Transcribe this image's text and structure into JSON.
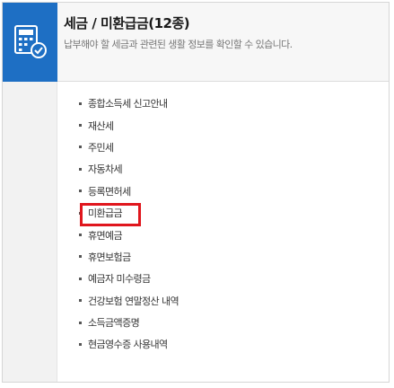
{
  "header": {
    "title": "세금 / 미환급금(12종)",
    "description": "납부해야 할 세금과 관련된 생활 정보를 확인할 수 있습니다."
  },
  "icon": {
    "name": "calculator-check-icon",
    "tile_color": "#1e6fc4"
  },
  "items": [
    {
      "label": "종합소득세 신고안내"
    },
    {
      "label": "재산세"
    },
    {
      "label": "주민세"
    },
    {
      "label": "자동차세"
    },
    {
      "label": "등록면허세"
    },
    {
      "label": "미환급금",
      "highlighted": true
    },
    {
      "label": "휴면예금"
    },
    {
      "label": "휴면보험금"
    },
    {
      "label": "예금자 미수령금"
    },
    {
      "label": "건강보험 연말정산 내역"
    },
    {
      "label": "소득금액증명"
    },
    {
      "label": "현금영수증 사용내역"
    }
  ],
  "colors": {
    "highlight_border": "#e0161d",
    "accent": "#1e6fc4"
  }
}
